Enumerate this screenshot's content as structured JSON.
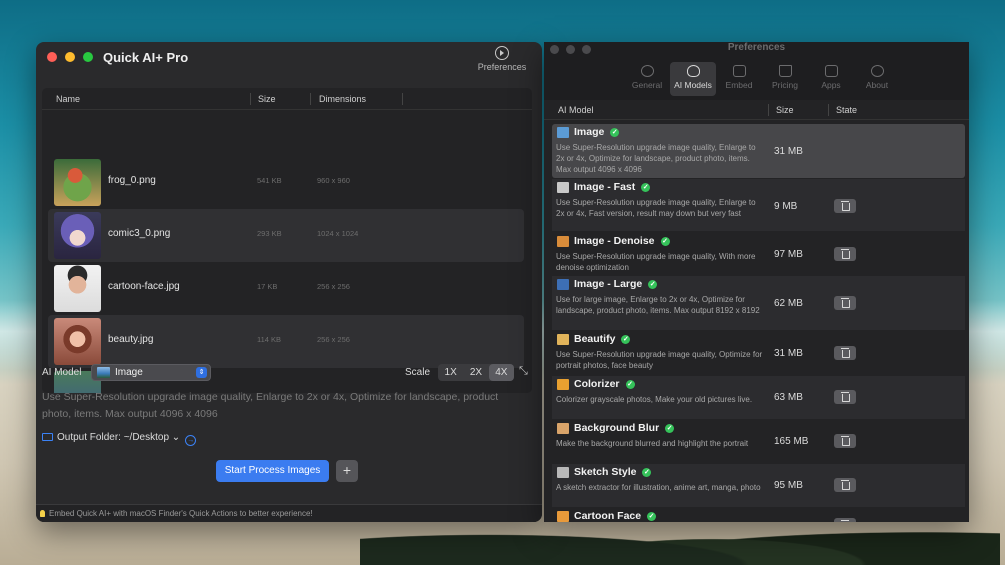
{
  "left_window": {
    "title": "Quick AI+ Pro",
    "preferences_label": "Preferences",
    "columns": {
      "name": "Name",
      "size": "Size",
      "dimensions": "Dimensions"
    },
    "files": [
      {
        "name": "frog_0.png",
        "size": "541 KB",
        "dimensions": "960 x 960",
        "thumb": "frog"
      },
      {
        "name": "comic3_0.png",
        "size": "293 KB",
        "dimensions": "1024 x 1024",
        "thumb": "comic"
      },
      {
        "name": "cartoon-face.jpg",
        "size": "17 KB",
        "dimensions": "256 x 256",
        "thumb": "cartoon"
      },
      {
        "name": "beauty.jpg",
        "size": "114 KB",
        "dimensions": "256 x 256",
        "thumb": "beauty"
      }
    ],
    "ai_model_label": "AI Model",
    "selected_model": "Image",
    "scale_label": "Scale",
    "scale_options": [
      "1X",
      "2X",
      "4X"
    ],
    "selected_scale": "4X",
    "model_description": "Use Super-Resolution upgrade image quality, Enlarge to 2x or 4x, Optimize for landscape, product photo, items. Max output 4096 x 4096",
    "output_folder": "Output Folder: ~/Desktop",
    "start_button": "Start Process Images",
    "add_button": "+",
    "footer_tip": "Embed Quick AI+ with macOS Finder's Quick Actions to better experience!"
  },
  "right_window": {
    "title": "Preferences",
    "tabs": [
      {
        "label": "General",
        "icon": "play-circle-icon",
        "selected": false
      },
      {
        "label": "AI Models",
        "icon": "brain-icon",
        "selected": true
      },
      {
        "label": "Embed",
        "icon": "embed-icon",
        "selected": false
      },
      {
        "label": "Pricing",
        "icon": "crown-icon",
        "selected": false
      },
      {
        "label": "Apps",
        "icon": "apps-icon",
        "selected": false
      },
      {
        "label": "About",
        "icon": "info-icon",
        "selected": false
      }
    ],
    "columns": {
      "model": "AI Model",
      "size": "Size",
      "state": "State"
    },
    "models": [
      {
        "name": "Image",
        "desc": "Use Super-Resolution upgrade image quality, Enlarge to 2x or 4x, Optimize for landscape, product photo, items. Max output 4096 x 4096",
        "size": "31 MB",
        "icon_color": "#5b9bd5",
        "deletable": false
      },
      {
        "name": "Image - Fast",
        "desc": "Use Super-Resolution upgrade image quality, Enlarge to 2x or 4x, Fast version, result may down but very fast",
        "size": "9 MB",
        "icon_color": "#c8c8c8",
        "deletable": true
      },
      {
        "name": "Image - Denoise",
        "desc": "Use Super-Resolution upgrade image quality, With more denoise optimization",
        "size": "97 MB",
        "icon_color": "#d98c3a",
        "deletable": true
      },
      {
        "name": "Image - Large",
        "desc": "Use for large image, Enlarge to 2x or 4x, Optimize for landscape, product photo, items. Max output 8192 x 8192",
        "size": "62 MB",
        "icon_color": "#3d6fb5",
        "deletable": true
      },
      {
        "name": "Beautify",
        "desc": "Use Super-Resolution upgrade image quality, Optimize for portrait photos, face beauty",
        "size": "31 MB",
        "icon_color": "#e0b35a",
        "deletable": true
      },
      {
        "name": "Colorizer",
        "desc": "Colorizer grayscale photos, Make your old pictures live.",
        "size": "63 MB",
        "icon_color": "#e8a030",
        "deletable": true
      },
      {
        "name": "Background Blur",
        "desc": "Make the background blurred and highlight the portrait",
        "size": "165 MB",
        "icon_color": "#d9a46a",
        "deletable": true
      },
      {
        "name": "Sketch Style",
        "desc": "A sketch extractor for illustration, anime art, manga, photo",
        "size": "95 MB",
        "icon_color": "#b8b8b8",
        "deletable": true
      },
      {
        "name": "Cartoon Face",
        "desc": "",
        "size": "",
        "icon_color": "#e89a3a",
        "deletable": true
      }
    ]
  }
}
